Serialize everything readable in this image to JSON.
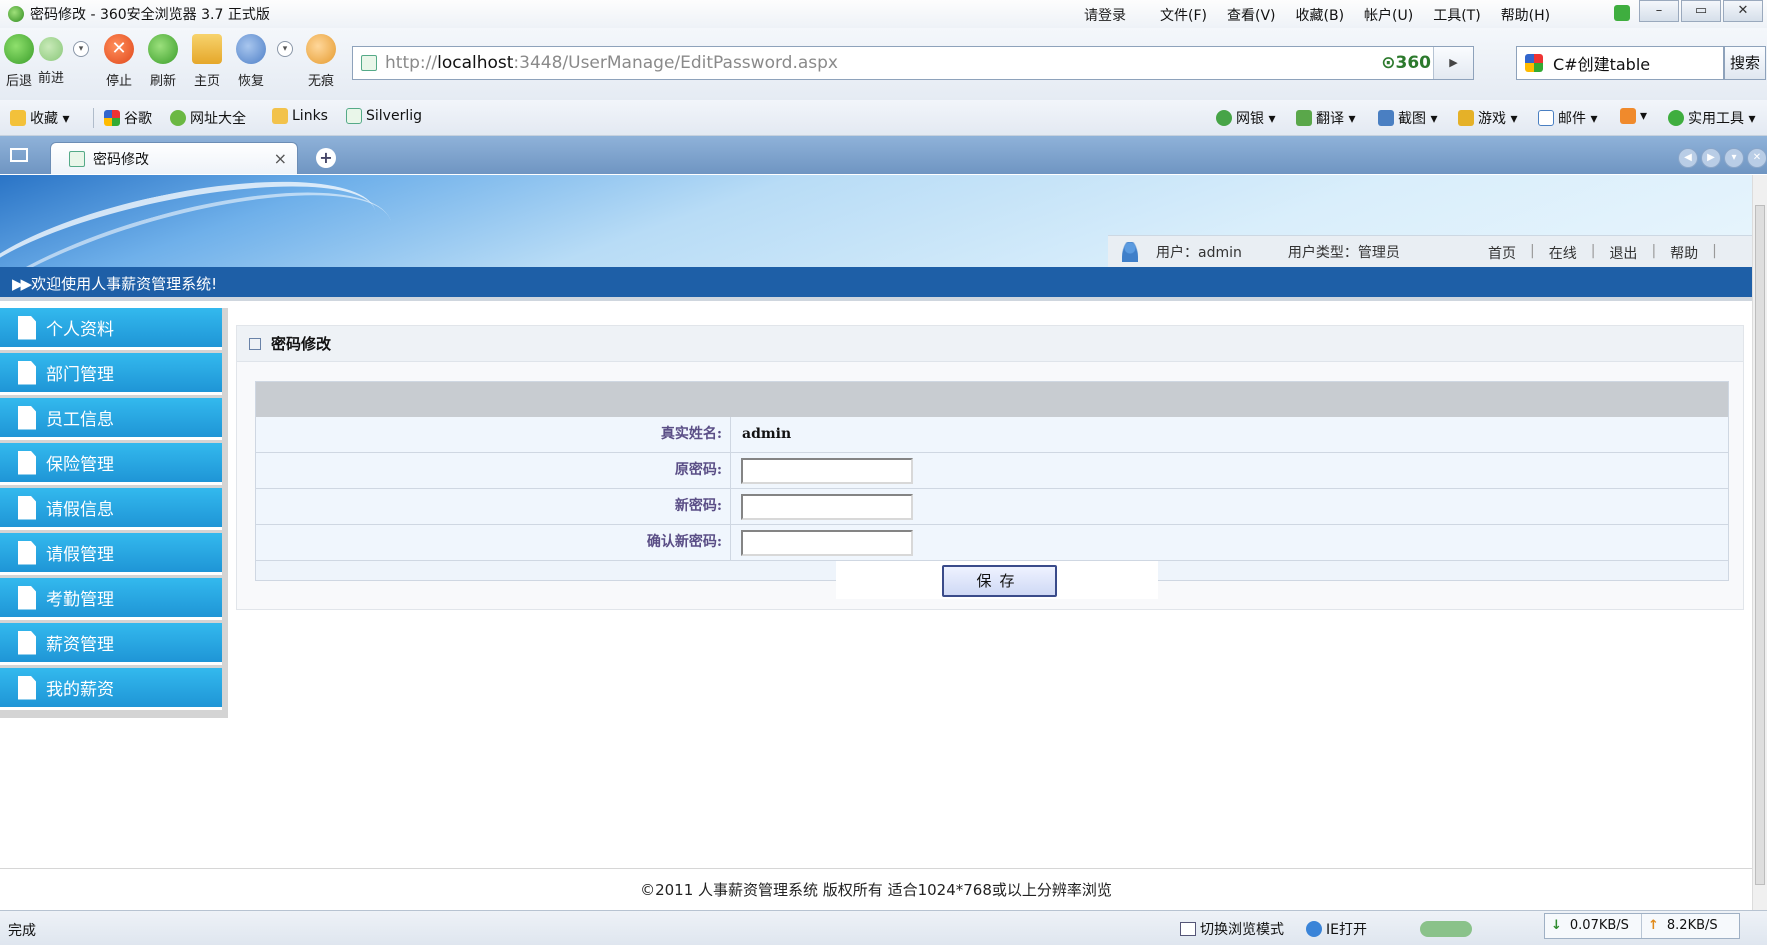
{
  "browser": {
    "window_title": "密码修改 - 360安全浏览器 3.7 正式版",
    "login": "请登录",
    "menus": [
      "文件(F)",
      "查看(V)",
      "收藏(B)",
      "帐户(U)",
      "工具(T)",
      "帮助(H)"
    ],
    "window_buttons": [
      "–",
      "▭",
      "✕"
    ],
    "nav": {
      "back": "后退",
      "forward": "前进",
      "stop": "停止",
      "refresh": "刷新",
      "home": "主页",
      "restore": "恢复",
      "notrace": "无痕"
    },
    "address": {
      "url_prefix": "http://",
      "url_host": "localhost",
      "url_rest": ":3448/UserManage/EditPassword.aspx",
      "badge": "⊙360"
    },
    "search": {
      "query": "C#创建table",
      "button": "搜索"
    },
    "favorites": {
      "label": "收藏 ▾",
      "items": [
        "谷歌",
        "网址大全",
        "Links",
        "Silverlig"
      ],
      "right_items": [
        "网银 ▾",
        "翻译 ▾",
        "截图 ▾",
        "游戏 ▾",
        "邮件 ▾",
        "▾",
        "实用工具 ▾"
      ]
    },
    "tab": {
      "title": "密码修改",
      "close": "×",
      "new_tab": "+"
    }
  },
  "site": {
    "user_label": "用户：admin",
    "user_type_label": "用户类型：管理员",
    "top_links": [
      "首页",
      "在线",
      "退出",
      "帮助"
    ],
    "welcome": "欢迎使用人事薪资管理系统!",
    "welcome_arrow": "▶▶",
    "sidebar": [
      "个人资料",
      "部门管理",
      "员工信息",
      "保险管理",
      "请假信息",
      "请假管理",
      "考勤管理",
      "薪资管理",
      "我的薪资"
    ],
    "panel_title": "密码修改",
    "form": {
      "realname_label": "真实姓名:",
      "realname_value": "admin",
      "old_pwd_label": "原密码:",
      "new_pwd_label": "新密码:",
      "confirm_pwd_label": "确认新密码:",
      "save_button": "保存"
    },
    "footer": "©2011 人事薪资管理系统  版权所有  适合1024*768或以上分辨率浏览"
  },
  "statusbar": {
    "status": "完成",
    "switch_mode": "切换浏览模式",
    "ie_open": "IE打开",
    "download_speed": "0.07KB/S",
    "upload_speed": "8.2KB/S"
  }
}
